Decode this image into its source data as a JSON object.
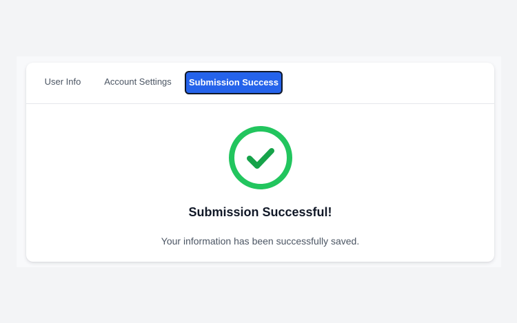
{
  "tabs": [
    {
      "label": "User Info",
      "active": false
    },
    {
      "label": "Account Settings",
      "active": false
    },
    {
      "label": "Submission Success",
      "active": true
    }
  ],
  "success": {
    "icon": "check-circle-icon",
    "title": "Submission Successful!",
    "message": "Your information has been successfully saved."
  },
  "colors": {
    "accent": "#2563eb",
    "success": "#22c55e",
    "title_text": "#111827",
    "body_text": "#4b5563"
  }
}
